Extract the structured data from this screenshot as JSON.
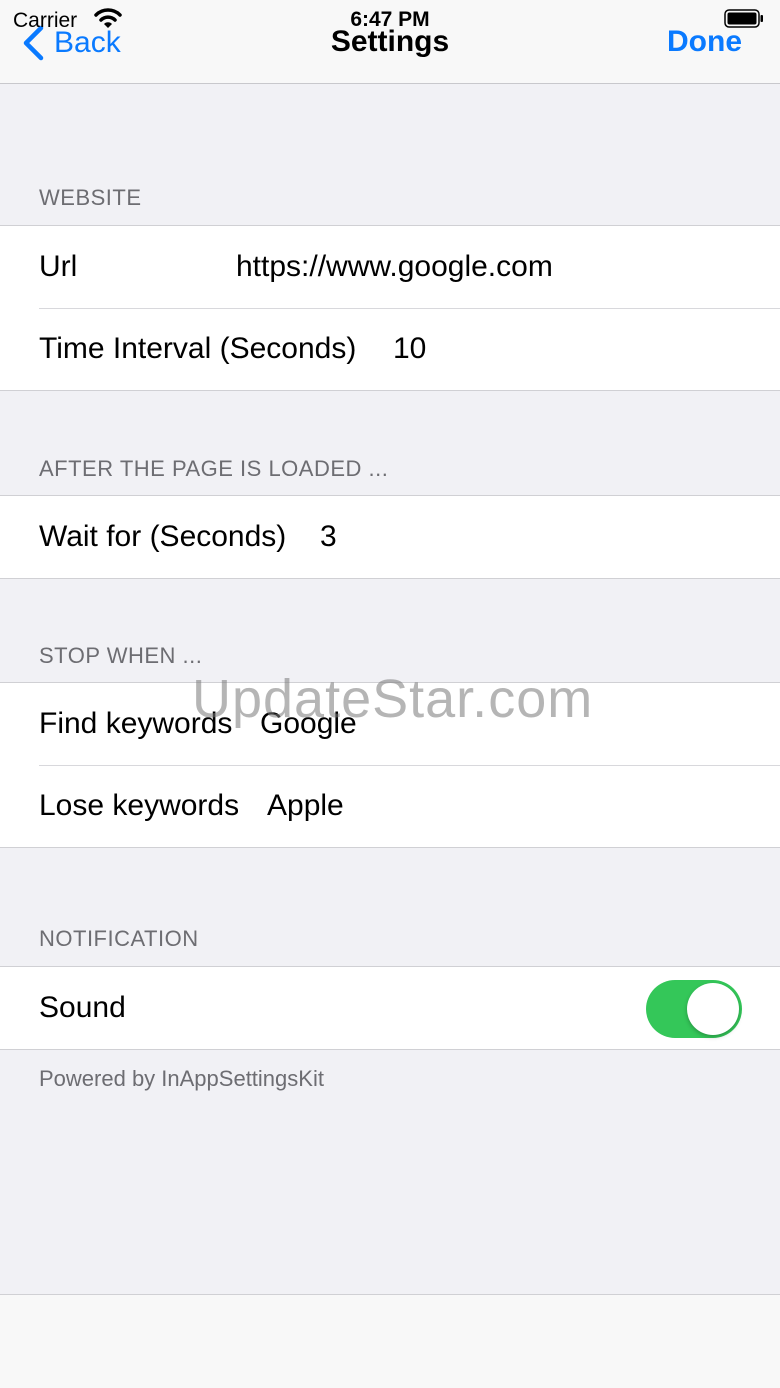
{
  "status": {
    "carrier": "Carrier",
    "time": "6:47 PM"
  },
  "nav": {
    "back_label": "Back",
    "title": "Settings",
    "done_label": "Done"
  },
  "sections": {
    "website": {
      "header": "WEBSITE",
      "url_label": "Url",
      "url_value": "https://www.google.com",
      "interval_label": "Time Interval (Seconds)",
      "interval_value": "10"
    },
    "after_load": {
      "header": "AFTER THE PAGE IS LOADED ...",
      "wait_label": "Wait for (Seconds)",
      "wait_value": "3"
    },
    "stop_when": {
      "header": "STOP WHEN ...",
      "find_label": "Find keywords",
      "find_value": "Google",
      "lose_label": "Lose keywords",
      "lose_value": "Apple"
    },
    "notification": {
      "header": "NOTIFICATION",
      "sound_label": "Sound",
      "sound_on": true
    }
  },
  "footer": "Powered by InAppSettingsKit",
  "watermark": "UpdateStar.com",
  "colors": {
    "accent": "#0a7aff",
    "toggle_on": "#34c759",
    "background": "#f1f1f5"
  }
}
